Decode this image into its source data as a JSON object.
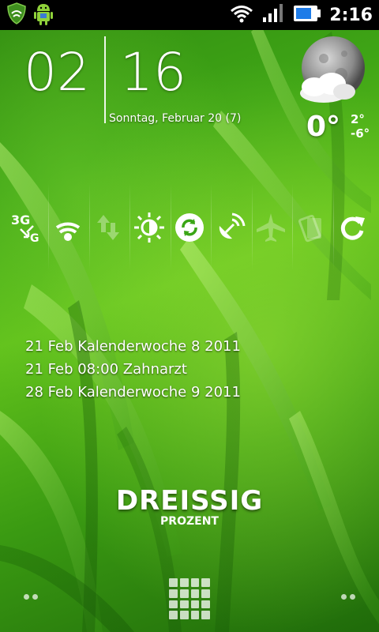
{
  "status_bar": {
    "time": "2:16",
    "icons": [
      "shield-icon",
      "android-icon",
      "wifi-icon",
      "signal-icon",
      "battery-icon"
    ]
  },
  "clock": {
    "hour": "02",
    "minute": "16",
    "date": "Sonntag, Februar 20 (7)"
  },
  "weather": {
    "current_temp": "0°",
    "high": "2°",
    "low": "-6°",
    "icon": "moon-cloud-icon"
  },
  "toggles": [
    {
      "name": "3g-toggle",
      "icon": "3g-switch-icon"
    },
    {
      "name": "wifi-toggle",
      "icon": "wifi-icon"
    },
    {
      "name": "data-sync-arrows-toggle",
      "icon": "up-down-arrows-icon"
    },
    {
      "name": "brightness-toggle",
      "icon": "brightness-icon"
    },
    {
      "name": "sync-toggle",
      "icon": "sync-icon"
    },
    {
      "name": "gps-toggle",
      "icon": "satellite-icon"
    },
    {
      "name": "airplane-toggle",
      "icon": "airplane-icon"
    },
    {
      "name": "rotation-toggle",
      "icon": "rotation-icon"
    },
    {
      "name": "refresh-toggle",
      "icon": "refresh-icon"
    }
  ],
  "events": [
    "21 Feb Kalenderwoche 8 2011",
    "21 Feb 08:00 Zahnarzt",
    "28 Feb Kalenderwoche 9 2011"
  ],
  "brand": {
    "title": "DREISSIG",
    "subtitle": "PROZENT"
  }
}
